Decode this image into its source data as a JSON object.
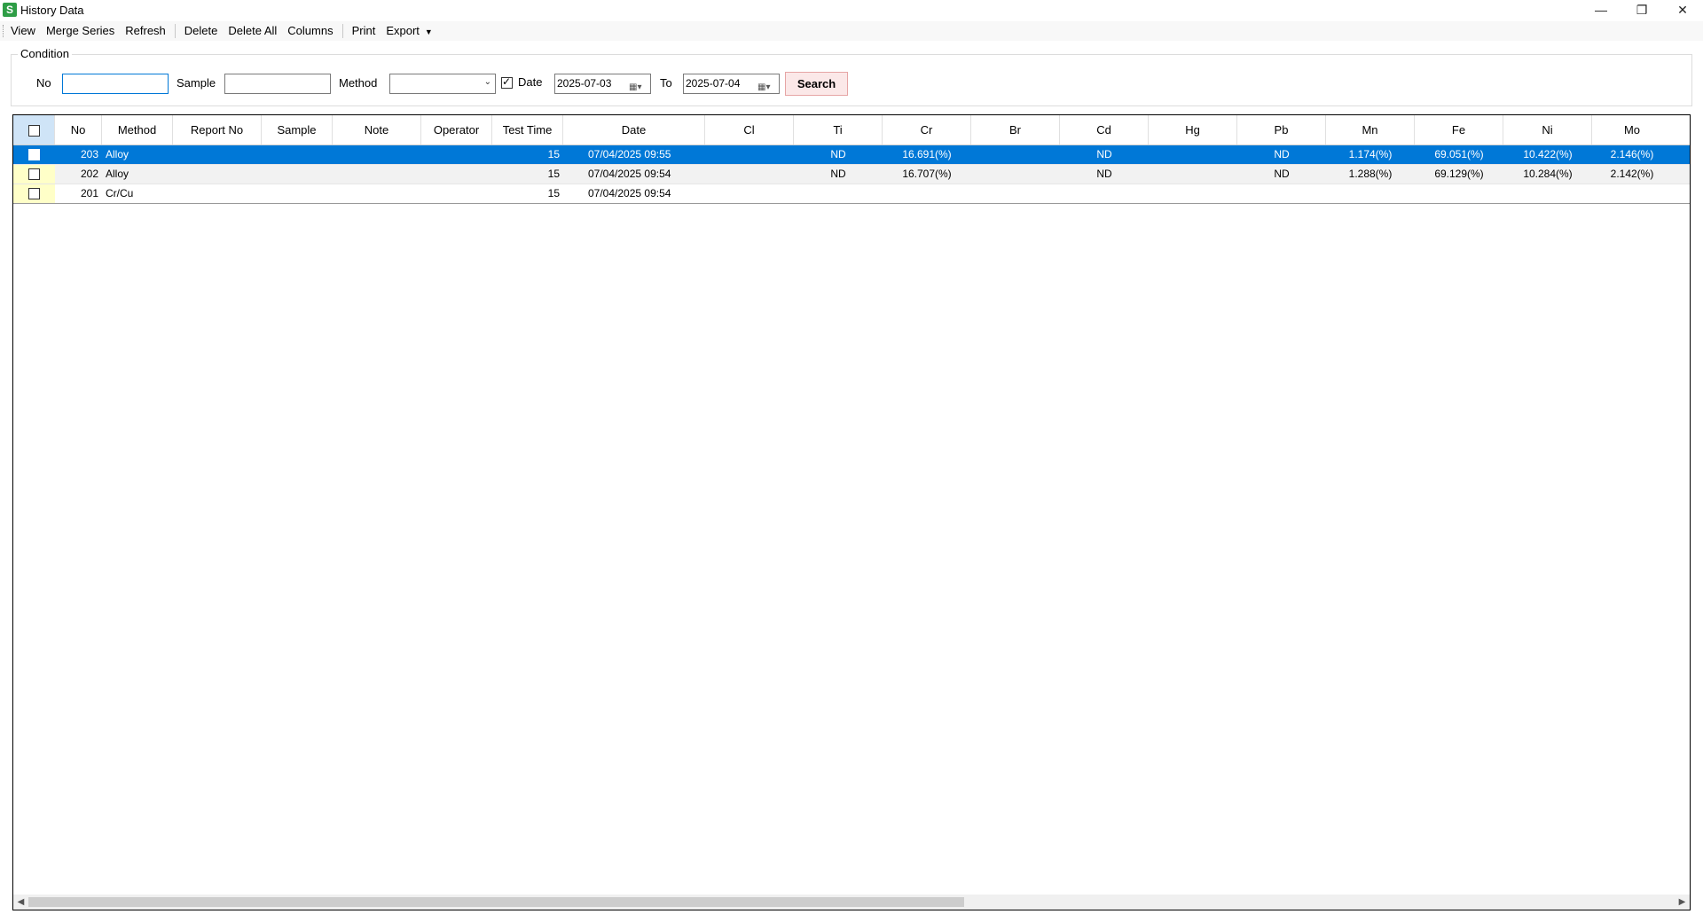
{
  "window": {
    "title": "History Data",
    "icon_letter": "S",
    "controls": [
      "minimize-icon",
      "restore-icon",
      "close-icon"
    ]
  },
  "toolbar": {
    "view": "View",
    "merge_series": "Merge Series",
    "refresh": "Refresh",
    "delete": "Delete",
    "delete_all": "Delete All",
    "columns": "Columns",
    "print": "Print",
    "export": "Export"
  },
  "condition": {
    "legend": "Condition",
    "no_label": "No",
    "no_value": "",
    "sample_label": "Sample",
    "sample_value": "",
    "method_label": "Method",
    "method_value": "",
    "date_label": "Date",
    "date_checked": true,
    "date_from": "2025-07-03",
    "to_label": "To",
    "date_to": "2025-07-04",
    "search_label": "Search"
  },
  "grid": {
    "columns": [
      "No",
      "Method",
      "Report No",
      "Sample",
      "Note",
      "Operator",
      "Test Time",
      "Date",
      "Cl",
      "Ti",
      "Cr",
      "Br",
      "Cd",
      "Hg",
      "Pb",
      "Mn",
      "Fe",
      "Ni",
      "Mo"
    ],
    "rows": [
      {
        "no": "203",
        "method": "Alloy",
        "report_no": "",
        "sample": "",
        "note": "",
        "operator": "",
        "test_time": "15",
        "date": "07/04/2025 09:55",
        "cl": "",
        "ti": "ND",
        "cr": "16.691(%)",
        "br": "",
        "cd": "ND",
        "hg": "",
        "pb": "ND",
        "mn": "1.174(%)",
        "fe": "69.051(%)",
        "ni": "10.422(%)",
        "mo": "2.146(%)",
        "selected": true
      },
      {
        "no": "202",
        "method": "Alloy",
        "report_no": "",
        "sample": "",
        "note": "",
        "operator": "",
        "test_time": "15",
        "date": "07/04/2025 09:54",
        "cl": "",
        "ti": "ND",
        "cr": "16.707(%)",
        "br": "",
        "cd": "ND",
        "hg": "",
        "pb": "ND",
        "mn": "1.288(%)",
        "fe": "69.129(%)",
        "ni": "10.284(%)",
        "mo": "2.142(%)",
        "selected": false
      },
      {
        "no": "201",
        "method": "Cr/Cu",
        "report_no": "",
        "sample": "",
        "note": "",
        "operator": "",
        "test_time": "15",
        "date": "07/04/2025 09:54",
        "cl": "",
        "ti": "",
        "cr": "",
        "br": "",
        "cd": "",
        "hg": "",
        "pb": "",
        "mn": "",
        "fe": "",
        "ni": "",
        "mo": "",
        "selected": false
      }
    ]
  },
  "colors": {
    "selection": "#0078d7",
    "search_button": "#fbe8e8"
  }
}
